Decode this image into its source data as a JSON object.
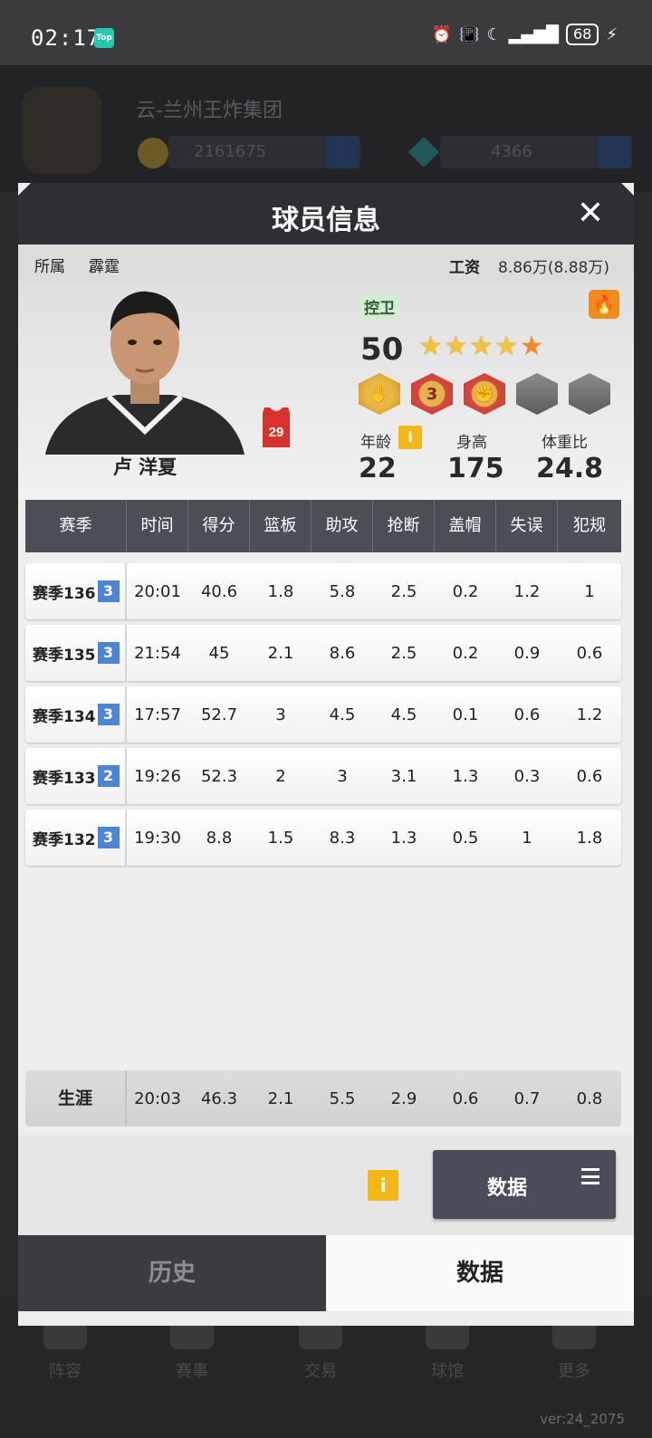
{
  "status_bar": {
    "time": "02:17",
    "app_badge": "Top",
    "battery": "68"
  },
  "background": {
    "team_name": "云-兰州王炸集团",
    "coins": "2161675",
    "gems": "4366",
    "nav": [
      "阵容",
      "赛事",
      "交易",
      "球馆",
      "更多"
    ],
    "version": "ver:24_2075"
  },
  "modal": {
    "title": "球员信息",
    "team_label": "所属",
    "team_name": "霹霆",
    "salary_label": "工资",
    "salary_value": "8.86万(8.88万)"
  },
  "player": {
    "name": "卢 洋夏",
    "jersey_number": "29",
    "position": "控卫",
    "overall": "50",
    "stars": 4.5,
    "age_label": "年龄",
    "age": "22",
    "height_label": "身高",
    "height": "175",
    "weight_ratio_label": "体重比",
    "weight_ratio": "24.8",
    "badge_level": "3",
    "info_icon": "i"
  },
  "table": {
    "headers": [
      "赛季",
      "时间",
      "得分",
      "篮板",
      "助攻",
      "抢断",
      "盖帽",
      "失误",
      "犯规"
    ],
    "rows": [
      {
        "season": "赛季136",
        "tier": "3",
        "time": "20:01",
        "pts": "40.6",
        "reb": "1.8",
        "ast": "5.8",
        "stl": "2.5",
        "blk": "0.2",
        "tov": "1.2",
        "pf": "1"
      },
      {
        "season": "赛季135",
        "tier": "3",
        "time": "21:54",
        "pts": "45",
        "reb": "2.1",
        "ast": "8.6",
        "stl": "2.5",
        "blk": "0.2",
        "tov": "0.9",
        "pf": "0.6"
      },
      {
        "season": "赛季134",
        "tier": "3",
        "time": "17:57",
        "pts": "52.7",
        "reb": "3",
        "ast": "4.5",
        "stl": "4.5",
        "blk": "0.1",
        "tov": "0.6",
        "pf": "1.2"
      },
      {
        "season": "赛季133",
        "tier": "2",
        "time": "19:26",
        "pts": "52.3",
        "reb": "2",
        "ast": "3",
        "stl": "3.1",
        "blk": "1.3",
        "tov": "0.3",
        "pf": "0.6"
      },
      {
        "season": "赛季132",
        "tier": "3",
        "time": "19:30",
        "pts": "8.8",
        "reb": "1.5",
        "ast": "8.3",
        "stl": "1.3",
        "blk": "0.5",
        "tov": "1",
        "pf": "1.8"
      }
    ],
    "career": {
      "label": "生涯",
      "time": "20:03",
      "pts": "46.3",
      "reb": "2.1",
      "ast": "5.5",
      "stl": "2.9",
      "blk": "0.6",
      "tov": "0.7",
      "pf": "0.8"
    }
  },
  "actions": {
    "info_label": "i",
    "data_button_label": "数据"
  },
  "tabs": {
    "history": "历史",
    "data": "数据"
  },
  "colors": {
    "header_bg": "#2d2f34",
    "table_header_bg": "#4b4e55",
    "tier_badge": "#4d84d6",
    "info_yellow": "#f2b817"
  }
}
